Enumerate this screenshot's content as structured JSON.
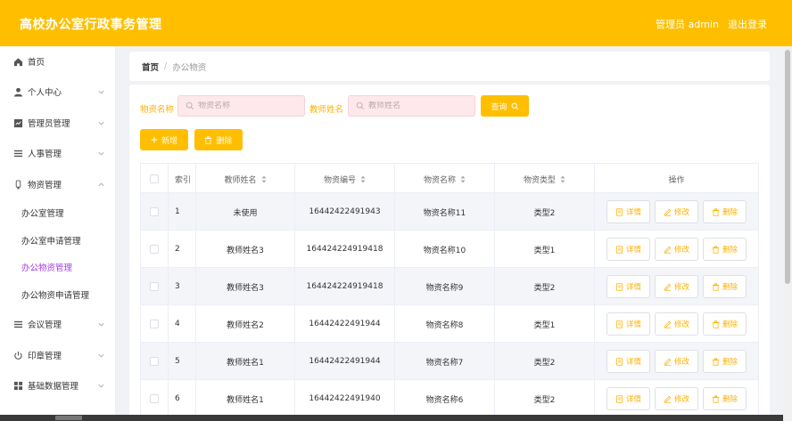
{
  "header": {
    "title": "高校办公室行政事务管理",
    "user": "管理员 admin",
    "logout": "退出登录"
  },
  "sidebar": {
    "items": [
      {
        "label": "首页",
        "icon": "home-icon"
      },
      {
        "label": "个人中心",
        "icon": "user-icon"
      },
      {
        "label": "管理员管理",
        "icon": "admin-icon"
      },
      {
        "label": "人事管理",
        "icon": "list-icon"
      },
      {
        "label": "物资管理",
        "icon": "supplies-icon"
      },
      {
        "label": "会议管理",
        "icon": "list-icon"
      },
      {
        "label": "印章管理",
        "icon": "power-icon"
      },
      {
        "label": "基础数据管理",
        "icon": "grid-icon"
      }
    ],
    "sub_items": [
      {
        "label": "办公室管理"
      },
      {
        "label": "办公室申请管理"
      },
      {
        "label": "办公物资管理",
        "active": true
      },
      {
        "label": "办公物资申请管理"
      }
    ]
  },
  "breadcrumb": {
    "home": "首页",
    "separator": "/",
    "current": "办公物资"
  },
  "search": {
    "name_label": "物资名称",
    "name_placeholder": "物资名称",
    "teacher_label": "教师姓名",
    "teacher_placeholder": "教师姓名",
    "query_button": "查询"
  },
  "toolbar": {
    "add_button": "新增",
    "delete_button": "删除"
  },
  "table": {
    "headers": [
      "索引",
      "教师姓名",
      "物资编号",
      "物资名称",
      "物资类型",
      "操作"
    ],
    "actions": {
      "detail": "详情",
      "edit": "修改",
      "delete": "删除"
    },
    "rows": [
      {
        "index": "1",
        "teacher": "未使用",
        "code": "16442422491943",
        "name": "物资名称11",
        "type": "类型2"
      },
      {
        "index": "2",
        "teacher": "教师姓名3",
        "code": "164424224919418",
        "name": "物资名称10",
        "type": "类型1"
      },
      {
        "index": "3",
        "teacher": "教师姓名3",
        "code": "164424224919418",
        "name": "物资名称9",
        "type": "类型2"
      },
      {
        "index": "4",
        "teacher": "教师姓名2",
        "code": "16442422491944",
        "name": "物资名称8",
        "type": "类型1"
      },
      {
        "index": "5",
        "teacher": "教师姓名1",
        "code": "16442422491944",
        "name": "物资名称7",
        "type": "类型2"
      },
      {
        "index": "6",
        "teacher": "教师姓名1",
        "code": "16442422491940",
        "name": "物资名称6",
        "type": "类型2"
      }
    ]
  },
  "colors": {
    "accent": "#ffbf00",
    "active_menu": "#a63ce0",
    "label": "#ffb000"
  }
}
